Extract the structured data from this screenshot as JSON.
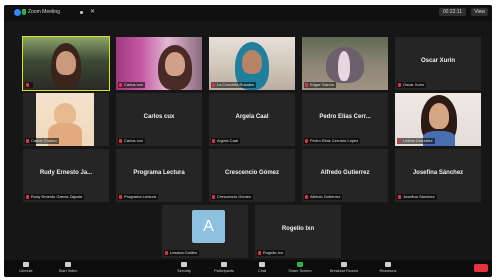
{
  "window": {
    "title": "Zoom Meeting",
    "timer": "00:22:11",
    "view_label": "View"
  },
  "participants": [
    {
      "name": "",
      "label": "",
      "video": "vid1",
      "active": true
    },
    {
      "name": "",
      "label": "Carlos cux",
      "video": "vid2"
    },
    {
      "name": "",
      "label": "La Conchita Rosales",
      "video": "vid3"
    },
    {
      "name": "",
      "label": "Edgar García",
      "video": "vid4"
    },
    {
      "name": "Oscar Xurin",
      "label": "Oscar Xurin"
    },
    {
      "name": "",
      "label": "Carlos Chamo",
      "photo": true
    },
    {
      "name": "Carlos cux",
      "label": "Carlos cux"
    },
    {
      "name": "Argela Caal",
      "label": "Argela Caal"
    },
    {
      "name": "Pedro Elías Cerr...",
      "label": "Pedro Elías Cerrano López"
    },
    {
      "name": "",
      "label": "Leticia Gonzalez",
      "video": "vid5"
    },
    {
      "name": "Rudy Ernesto Ja...",
      "label": "Rudy Ernesto García Zapata"
    },
    {
      "name": "Programa Lectura",
      "label": "Programa Lectura"
    },
    {
      "name": "Crescencio Gómez",
      "label": "Crescencio Gómez"
    },
    {
      "name": "Alfredo Gutierrez",
      "label": "Alfredo Gutierrez"
    },
    {
      "name": "Josefina Sánchez",
      "label": "Josefina Sánchez"
    },
    {
      "name": "",
      "label": "Lessica Guillén",
      "avatar": "A"
    },
    {
      "name": "Rogelio Ixn",
      "label": "Rogelio Ixn"
    }
  ],
  "toolbar": {
    "items": [
      {
        "label": "Unmute",
        "icon": "microphone-icon"
      },
      {
        "label": "Start Video",
        "icon": "video-camera-icon"
      },
      {
        "label": "Security",
        "icon": "shield-icon"
      },
      {
        "label": "Participants",
        "icon": "participants-icon"
      },
      {
        "label": "Chat",
        "icon": "chat-icon"
      },
      {
        "label": "Share Screen",
        "icon": "share-screen-icon"
      },
      {
        "label": "Breakout Rooms",
        "icon": "breakout-rooms-icon"
      },
      {
        "label": "Reactions",
        "icon": "reactions-icon"
      }
    ],
    "end_label": "End"
  },
  "colors": {
    "active_speaker": "#d6e619",
    "share_green": "#2fb04a",
    "end_red": "#e8323f",
    "zoom_blue": "#2d8cff"
  }
}
